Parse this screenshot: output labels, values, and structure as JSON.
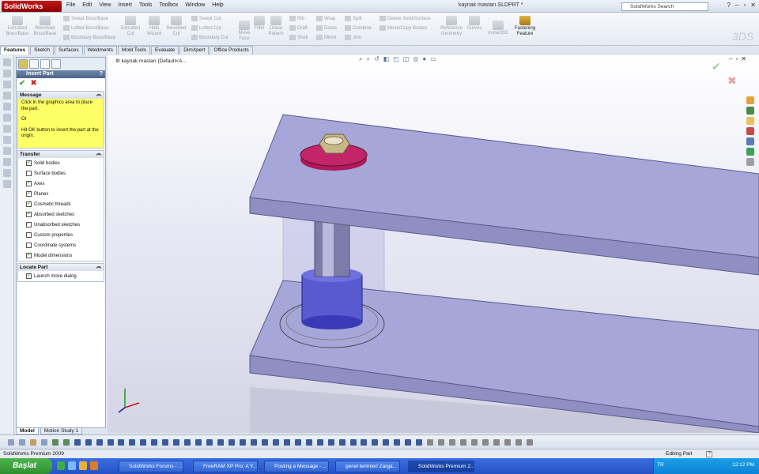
{
  "app": {
    "name": "SolidWorks",
    "document_title": "kaynak mastarı.SLDPRT *",
    "search_placeholder": "SolidWorks Search"
  },
  "menus": [
    "File",
    "Edit",
    "View",
    "Insert",
    "Tools",
    "Toolbox",
    "Window",
    "Help"
  ],
  "commands": {
    "extruded_bossbase": "Extruded Boss/Base",
    "revolved_bossbase": "Revolved Boss/Base",
    "swept_bossbase": "Swept Boss/Base",
    "lofted_bossbase": "Lofted Boss/Base",
    "boundary_bossbase": "Boundary Boss/Base",
    "extruded_cut": "Extruded Cut",
    "hole_wizard": "Hole Wizard",
    "revolved_cut": "Revolved Cut",
    "swept_cut": "Swept Cut",
    "lofted_cut": "Lofted Cut",
    "boundary_cut": "Boundary Cut",
    "move_face": "Move Face",
    "fillet": "Fillet",
    "linear_pattern": "Linear Pattern",
    "rib": "Rib",
    "draft": "Draft",
    "shell": "Shell",
    "wrap": "Wrap",
    "dome": "Dome",
    "mirror": "Mirror",
    "split": "Split",
    "combine": "Combine",
    "join": "Join",
    "delete_solid": "Delete Solid/Surface",
    "move_copy": "Move/Copy Bodies",
    "reference_geometry": "Reference Geometry",
    "curves": "Curves",
    "instant3d": "Instant3D",
    "fastening_feature": "Fastening Feature"
  },
  "tabs": [
    "Features",
    "Sketch",
    "Surfaces",
    "Weldments",
    "Mold Tools",
    "Evaluate",
    "DimXpert",
    "Office Products"
  ],
  "property_manager": {
    "title": "Insert Part",
    "help": "?",
    "message_header": "Message",
    "message_line1": "Click in the graphics area to place the part.",
    "message_or": "Or",
    "message_line2": "Hit OK button to insert the part at the origin.",
    "transfer_header": "Transfer",
    "transfer_items": [
      {
        "label": "Solid bodies",
        "checked": true
      },
      {
        "label": "Surface bodies",
        "checked": false
      },
      {
        "label": "Axes",
        "checked": true
      },
      {
        "label": "Planes",
        "checked": true
      },
      {
        "label": "Cosmetic threads",
        "checked": true
      },
      {
        "label": "Absorbed sketches",
        "checked": true
      },
      {
        "label": "Unabsorbed sketches",
        "checked": false
      },
      {
        "label": "Custom properties",
        "checked": false
      },
      {
        "label": "Coordinate systems",
        "checked": false
      },
      {
        "label": "Model dimensions",
        "checked": true
      }
    ],
    "locate_header": "Locate Part",
    "locate_items": [
      {
        "label": "Launch move dialog",
        "checked": true
      }
    ]
  },
  "bottom_tabs": [
    "Model",
    "Motion Study 1"
  ],
  "graphics": {
    "tree_label": "kaynak mastarı  (Default<A...",
    "plate_color": "#a6a6d8",
    "washer_color": "#b0195a",
    "spacer_color": "#5a5ad0"
  },
  "statusbar": {
    "left": "SolidWorks Premium 2009",
    "editing": "Editing Part",
    "help_btn": "?"
  },
  "taskbar": {
    "start": "Başlat",
    "items": [
      {
        "label": "SolidWorks Forums - ...",
        "active": false
      },
      {
        "label": "FreeRAM XP Pro: A Y...",
        "active": false
      },
      {
        "label": "Posting a Message - ...",
        "active": false
      },
      {
        "label": "genel terimleri Zarga...",
        "active": false
      },
      {
        "label": "SolidWorks Premium 2...",
        "active": true
      }
    ],
    "lang": "TR",
    "clock": "12:12 PM"
  }
}
